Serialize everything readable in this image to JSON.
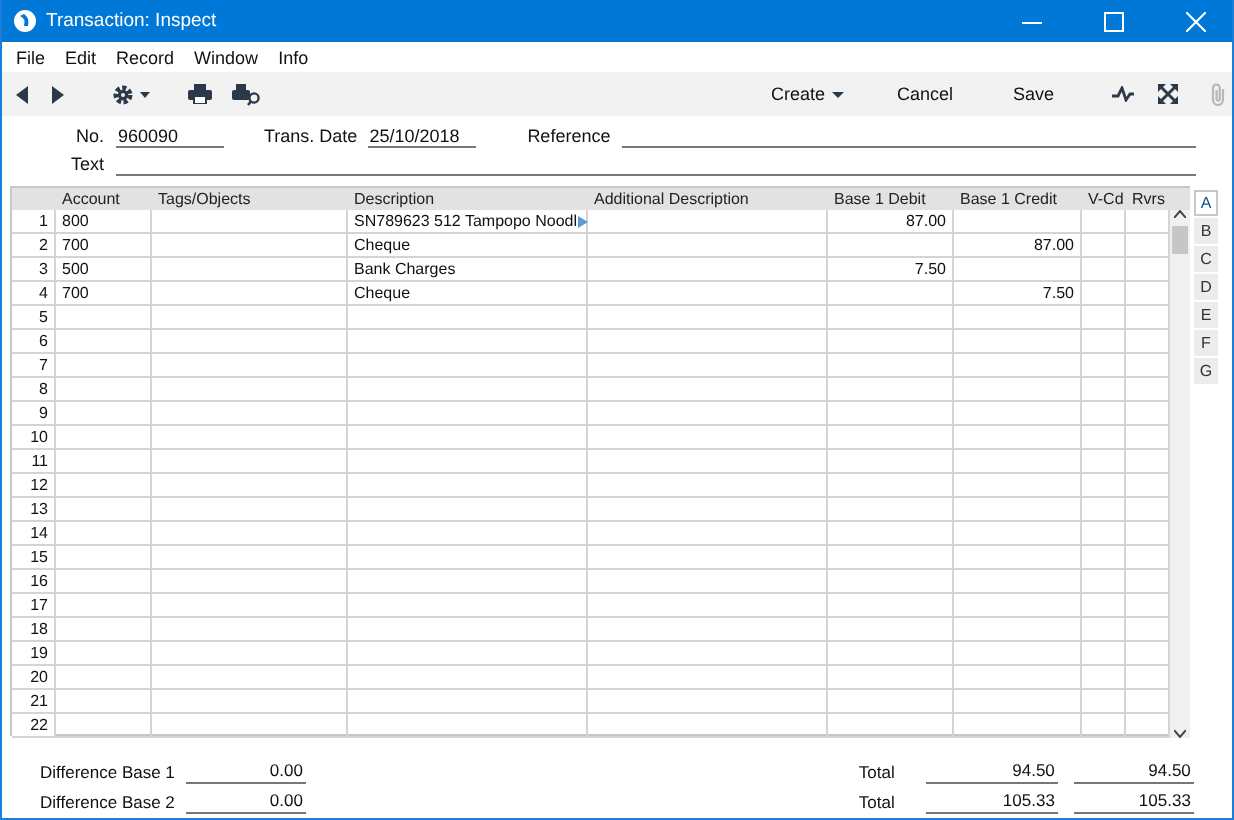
{
  "window": {
    "title": "Transaction: Inspect"
  },
  "menu": [
    "File",
    "Edit",
    "Record",
    "Window",
    "Info"
  ],
  "toolbar": {
    "buttons": [
      {
        "label": "Create",
        "kind": "dropdown"
      },
      {
        "label": "Cancel",
        "kind": "plain"
      },
      {
        "label": "Save",
        "kind": "plain"
      }
    ],
    "attach_disabled": true
  },
  "header": {
    "no_label": "No.",
    "no": "960090",
    "date_label": "Trans. Date",
    "date": "25/10/2018",
    "reference_label": "Reference",
    "text_label": "Text"
  },
  "table": {
    "columns": [
      "Account",
      "Tags/Objects",
      "Description",
      "Additional Description",
      "Base 1 Debit",
      "Base 1 Credit",
      "V-Cd",
      "Rvrs"
    ],
    "rows": [
      {
        "no": "1",
        "account": "800",
        "description": "SN789623 512 Tampopo Noodl",
        "overflow": true,
        "debit": "87.00"
      },
      {
        "no": "2",
        "account": "700",
        "description": "Cheque",
        "credit": "87.00"
      },
      {
        "no": "3",
        "account": "500",
        "description": "Bank Charges",
        "debit": "7.50"
      },
      {
        "no": "4",
        "account": "700",
        "description": "Cheque",
        "credit": "7.50"
      },
      {
        "no": "5"
      },
      {
        "no": "6"
      },
      {
        "no": "7"
      },
      {
        "no": "8"
      },
      {
        "no": "9"
      },
      {
        "no": "10"
      },
      {
        "no": "11"
      },
      {
        "no": "12"
      },
      {
        "no": "13"
      },
      {
        "no": "14"
      },
      {
        "no": "15"
      },
      {
        "no": "16"
      },
      {
        "no": "17"
      },
      {
        "no": "18"
      },
      {
        "no": "19"
      },
      {
        "no": "20"
      },
      {
        "no": "21"
      },
      {
        "no": "22"
      }
    ]
  },
  "side_tabs": [
    {
      "label": "A",
      "selected": true
    },
    {
      "label": "B",
      "selected": false
    },
    {
      "label": "C",
      "selected": false
    },
    {
      "label": "D",
      "selected": false
    },
    {
      "label": "E",
      "selected": false
    },
    {
      "label": "F",
      "selected": false
    },
    {
      "label": "G",
      "selected": false
    }
  ],
  "footer": {
    "left": [
      {
        "label": "Difference Base 1",
        "value": "0.00"
      },
      {
        "label": "Difference Base 2",
        "value": "0.00"
      }
    ],
    "right": [
      {
        "label": "Total",
        "debit": "94.50",
        "credit": "94.50"
      },
      {
        "label": "Total",
        "debit": "105.33",
        "credit": "105.33"
      }
    ]
  }
}
